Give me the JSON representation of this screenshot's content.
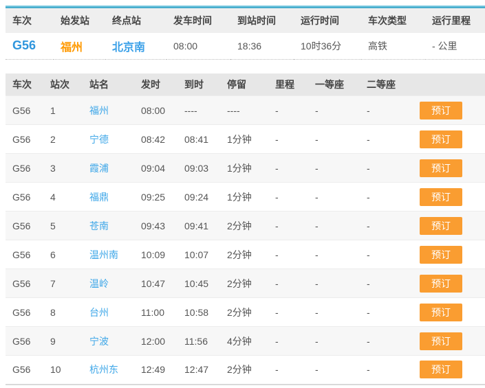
{
  "colors": {
    "accent_blue": "#2f9fc4",
    "link_blue": "#3fa7e8",
    "train_code_blue": "#2f96dd",
    "orange": "#fa9d31",
    "header_bg": "#efefef",
    "stops_header_bg": "#e7e7e7",
    "row_alt_bg": "#f7f7f7"
  },
  "summary": {
    "headers": [
      "车次",
      "始发站",
      "终点站",
      "发车时间",
      "到站时间",
      "运行时间",
      "车次类型",
      "运行里程"
    ],
    "train": {
      "code": "G56",
      "origin": "福州",
      "terminal": "北京南",
      "depart_time": "08:00",
      "arrive_time": "18:36",
      "duration": "10时36分",
      "type": "高铁",
      "mileage": "- 公里"
    }
  },
  "stops": {
    "headers": [
      "车次",
      "站次",
      "站名",
      "发时",
      "到时",
      "停留",
      "里程",
      "一等座",
      "二等座"
    ],
    "book_label": "预订",
    "rows": [
      {
        "train": "G56",
        "no": "1",
        "station": "福州",
        "depart": "08:00",
        "arrive": "----",
        "stay": "----",
        "mileage": "-",
        "first_class": "-",
        "second_class": "-"
      },
      {
        "train": "G56",
        "no": "2",
        "station": "宁德",
        "depart": "08:42",
        "arrive": "08:41",
        "stay": "1分钟",
        "mileage": "-",
        "first_class": "-",
        "second_class": "-"
      },
      {
        "train": "G56",
        "no": "3",
        "station": "霞浦",
        "depart": "09:04",
        "arrive": "09:03",
        "stay": "1分钟",
        "mileage": "-",
        "first_class": "-",
        "second_class": "-"
      },
      {
        "train": "G56",
        "no": "4",
        "station": "福鼎",
        "depart": "09:25",
        "arrive": "09:24",
        "stay": "1分钟",
        "mileage": "-",
        "first_class": "-",
        "second_class": "-"
      },
      {
        "train": "G56",
        "no": "5",
        "station": "苍南",
        "depart": "09:43",
        "arrive": "09:41",
        "stay": "2分钟",
        "mileage": "-",
        "first_class": "-",
        "second_class": "-"
      },
      {
        "train": "G56",
        "no": "6",
        "station": "温州南",
        "depart": "10:09",
        "arrive": "10:07",
        "stay": "2分钟",
        "mileage": "-",
        "first_class": "-",
        "second_class": "-"
      },
      {
        "train": "G56",
        "no": "7",
        "station": "温岭",
        "depart": "10:47",
        "arrive": "10:45",
        "stay": "2分钟",
        "mileage": "-",
        "first_class": "-",
        "second_class": "-"
      },
      {
        "train": "G56",
        "no": "8",
        "station": "台州",
        "depart": "11:00",
        "arrive": "10:58",
        "stay": "2分钟",
        "mileage": "-",
        "first_class": "-",
        "second_class": "-"
      },
      {
        "train": "G56",
        "no": "9",
        "station": "宁波",
        "depart": "12:00",
        "arrive": "11:56",
        "stay": "4分钟",
        "mileage": "-",
        "first_class": "-",
        "second_class": "-"
      },
      {
        "train": "G56",
        "no": "10",
        "station": "杭州东",
        "depart": "12:49",
        "arrive": "12:47",
        "stay": "2分钟",
        "mileage": "-",
        "first_class": "-",
        "second_class": "-"
      }
    ]
  }
}
